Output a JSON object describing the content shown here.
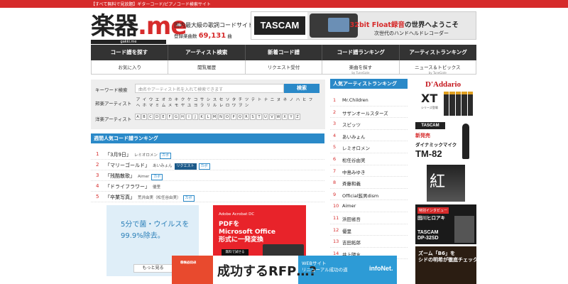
{
  "topbar": {
    "text": "【すべて無料で見放題】ギターコード/ピアノコード検索サイト"
  },
  "logo": {
    "main_a": "楽器",
    "main_b": ".me",
    "sub": "gakki.me"
  },
  "tagline": {
    "line1": "国内最大級の歌詞コードサイト",
    "registered_label": "登録楽曲数",
    "registered_count": "69,131",
    "registered_unit": "曲"
  },
  "banner": {
    "brand": "TASCAM",
    "line1_red": "32bit Float録音",
    "line1_rest": "の世界へようこそ",
    "line2": "次世代のハンドヘルドレコーダー"
  },
  "nav": {
    "row1": [
      "コード譜を探す",
      "アーティスト検索",
      "新着コード譜",
      "コード譜ランキング",
      "アーティストランキング"
    ],
    "row2": [
      {
        "label": "お気に入り",
        "sub": ""
      },
      {
        "label": "閲覧履歴",
        "sub": ""
      },
      {
        "label": "リクエスト受付",
        "sub": ""
      },
      {
        "label": "楽曲を探す",
        "sub": "by TuneGate"
      },
      {
        "label": "ニュース＆トピックス",
        "sub": "by TuneGate"
      }
    ]
  },
  "search": {
    "keyword_label": "キーワード検索",
    "placeholder": "曲名やアーティスト名を入れて検索できます",
    "button": "検索",
    "kana_label": "邦楽アーティスト",
    "kana": [
      "ア",
      "イ",
      "ウ",
      "エ",
      "オ",
      "カ",
      "キ",
      "ク",
      "ケ",
      "コ",
      "サ",
      "シ",
      "ス",
      "セ",
      "ソ",
      "タ",
      "チ",
      "ツ",
      "テ",
      "ト",
      "ナ",
      "ニ",
      "ヌ",
      "ネ",
      "ノ",
      "ハ",
      "ヒ",
      "フ",
      "ヘ",
      "ホ",
      "マ",
      "ミ",
      "ム",
      "メ",
      "モ",
      "ヤ",
      "ユ",
      "ヨ",
      "ラ",
      "リ",
      "ル",
      "レ",
      "ロ",
      "ワ",
      "ヲ",
      "ン"
    ],
    "abc_label": "洋楽アーティスト",
    "abc": [
      "A",
      "B",
      "C",
      "D",
      "E",
      "F",
      "G",
      "H",
      "I",
      "J",
      "K",
      "L",
      "M",
      "N",
      "O",
      "P",
      "Q",
      "R",
      "S",
      "T",
      "U",
      "V",
      "W",
      "X",
      "Y",
      "Z"
    ]
  },
  "weekly": {
    "heading": "週間人気コード譜ランキング",
    "items": [
      {
        "num": "1",
        "title": "「3月9日」",
        "artist": "レミオロメン",
        "tags": [
          "カポ"
        ]
      },
      {
        "num": "2",
        "title": "「マリーゴールド」",
        "artist": "あいみょん",
        "tags": [
          "リクエスト",
          "カポ"
        ]
      },
      {
        "num": "3",
        "title": "「残酷散歌」",
        "artist": "Aimer",
        "tags": [
          "カポ"
        ]
      },
      {
        "num": "4",
        "title": "「ドライフラワー」",
        "artist": "優里",
        "tags": []
      },
      {
        "num": "5",
        "title": "「卒業写真」",
        "artist": "荒井由実（松任谷由実）",
        "tags": [
          "カポ"
        ]
      }
    ]
  },
  "ads": {
    "ad1_text1": "5分で菌・ウイルスを",
    "ad1_text2": "99.9%除去。",
    "ad1_more": "もっと見る",
    "ad2_header": "Adobe Acrobat DC",
    "ad2_text1": "PDFを",
    "ad2_text2": "Microsoft Office",
    "ad2_text3": "形式に一発変換",
    "ad2_cta": "無料で試せる"
  },
  "popular": {
    "heading": "人気アーティストランキング",
    "items": [
      {
        "num": "1",
        "name": "Mr.Children"
      },
      {
        "num": "2",
        "name": "サザンオールスターズ"
      },
      {
        "num": "3",
        "name": "スピッツ"
      },
      {
        "num": "4",
        "name": "あいみょん"
      },
      {
        "num": "5",
        "name": "レミオロメン"
      },
      {
        "num": "6",
        "name": "松任谷由実"
      },
      {
        "num": "7",
        "name": "中島みゆき"
      },
      {
        "num": "8",
        "name": "斉藤和義"
      },
      {
        "num": "9",
        "name": "Official髭男dism"
      },
      {
        "num": "10",
        "name": "Aimer"
      },
      {
        "num": "11",
        "name": "浜田省吾"
      },
      {
        "num": "12",
        "name": "優里"
      },
      {
        "num": "13",
        "name": "吉田拓郎"
      },
      {
        "num": "14",
        "name": "井上陽水"
      }
    ]
  },
  "side_ads": {
    "daddario": "D'Addario",
    "xt": "XT",
    "xt_sub": "シリーズ登場",
    "tascam": "TASCAM",
    "new_release": "新発売",
    "mic_label": "ダイナミックマイク",
    "model": "TM-82",
    "kanji": "紅",
    "interview_tag": "特別インタビュー",
    "interview_name": "田川ヒロアキ",
    "dev1": "TASCAM",
    "dev2": "DP-32SD",
    "tip1": "ズーム「B6」を",
    "tip2": "シドの明希が徹底チェック"
  },
  "bottom_ad": {
    "left1": "新製品発表",
    "left2": "今すぐ",
    "left3": "Download",
    "main": "成功するRFP…?",
    "c1": "WEBサイト",
    "c2": "リニューアル成功の道",
    "brand": "infoNet."
  }
}
